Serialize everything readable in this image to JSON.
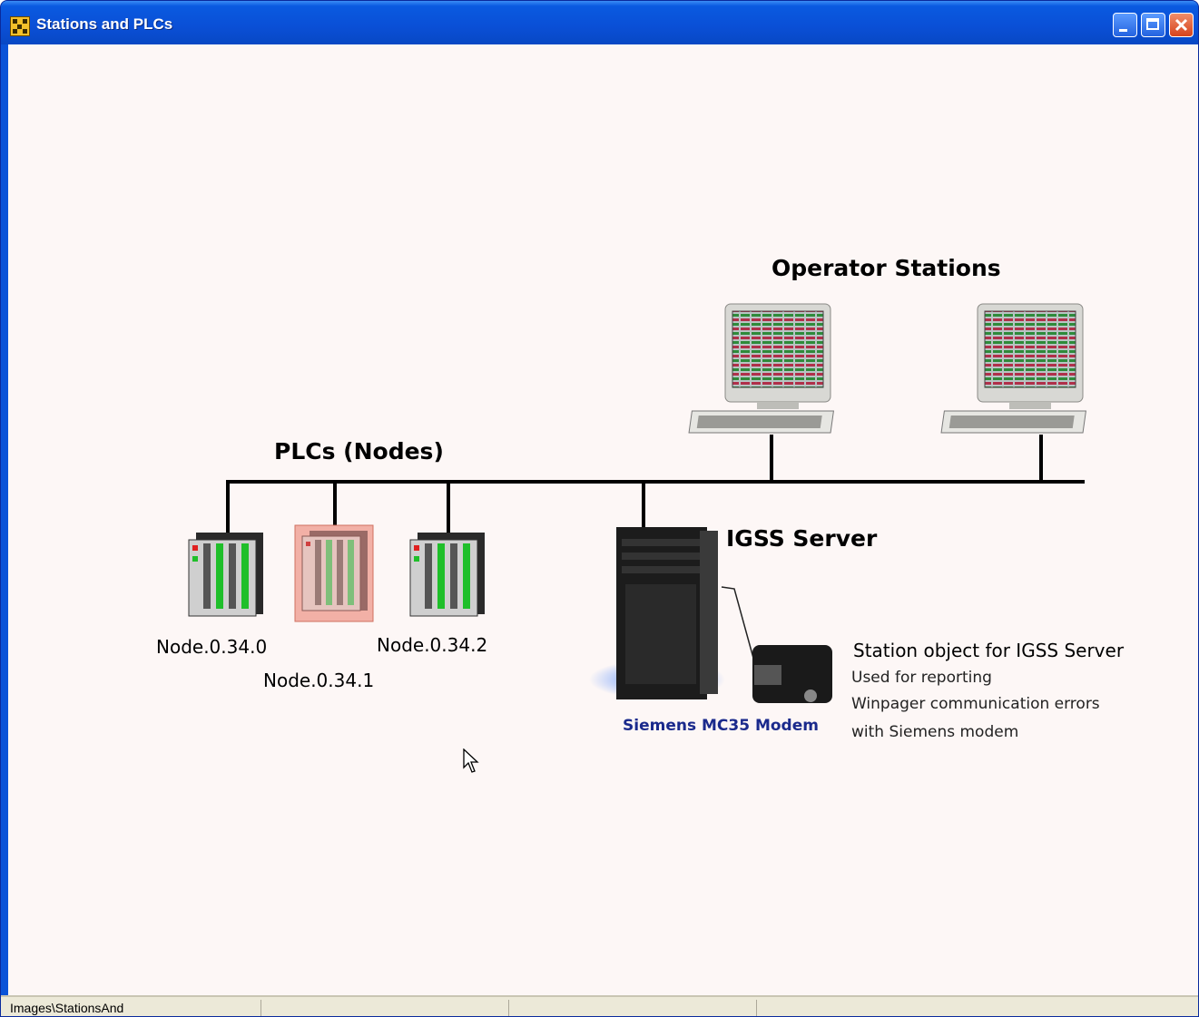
{
  "window": {
    "title": "Stations and PLCs"
  },
  "diagram": {
    "operator_stations_label": "Operator Stations",
    "plcs_label": "PLCs (Nodes)",
    "server_label": "IGSS Server",
    "nodes": [
      "Node.0.34.0",
      "Node.0.34.1",
      "Node.0.34.2"
    ],
    "modem_label": "Siemens MC35 Modem",
    "station_object": {
      "title": "Station object for IGSS Server",
      "lines": [
        "Used for reporting",
        "Winpager communication errors",
        "with Siemens modem"
      ]
    }
  },
  "statusbar": {
    "text": "Images\\StationsAnd"
  },
  "colors": {
    "titlebar": "#0a4fd6",
    "canvas": "#fdf7f6",
    "selected_node": "#f2b0a6",
    "modem_label": "#1a2a8c"
  }
}
